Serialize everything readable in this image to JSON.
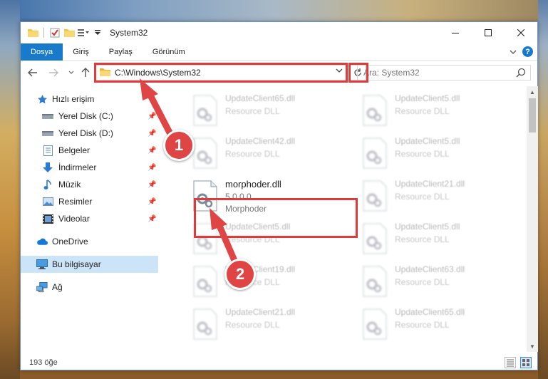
{
  "window": {
    "title": "System32",
    "controls": {
      "minimize": "—",
      "maximize": "☐",
      "close": "✕"
    }
  },
  "ribbon": {
    "tabs": [
      {
        "label": "Dosya",
        "active": true
      },
      {
        "label": "Giriş",
        "active": false
      },
      {
        "label": "Paylaş",
        "active": false
      },
      {
        "label": "Görünüm",
        "active": false
      }
    ],
    "help": "?"
  },
  "navigation": {
    "address_path": "C:\\Windows\\System32",
    "search_placeholder": "Ara: System32"
  },
  "sidebar": {
    "items": [
      {
        "label": "Hızlı erişim",
        "icon": "star-icon",
        "pinned": false
      },
      {
        "label": "Yerel Disk (C:)",
        "icon": "drive-icon",
        "pinned": true
      },
      {
        "label": "Yerel Disk (D:)",
        "icon": "drive-icon",
        "pinned": true
      },
      {
        "label": "Belgeler",
        "icon": "document-icon",
        "pinned": true
      },
      {
        "label": "İndirmeler",
        "icon": "download-icon",
        "pinned": true
      },
      {
        "label": "Müzik",
        "icon": "music-icon",
        "pinned": true
      },
      {
        "label": "Resimler",
        "icon": "picture-icon",
        "pinned": true
      },
      {
        "label": "Videolar",
        "icon": "video-icon",
        "pinned": true
      },
      {
        "label": "OneDrive",
        "icon": "cloud-icon",
        "pinned": false
      },
      {
        "label": "Bu bilgisayar",
        "icon": "computer-icon",
        "pinned": false,
        "selected": true
      },
      {
        "label": "Ağ",
        "icon": "network-icon",
        "pinned": false
      }
    ]
  },
  "files": {
    "left": [
      {
        "name": "UpdateClient65.dll",
        "desc": "Resource DLL"
      },
      {
        "name": "UpdateClient42.dll",
        "desc": "Resource DLL"
      },
      {
        "name": "morphoder.dll",
        "version": "5.0.0.0",
        "desc": "Morphoder",
        "highlighted": true
      },
      {
        "name": "UpdateClient5.dll",
        "desc": "Resource DLL"
      },
      {
        "name": "UpdateClient19.dll",
        "desc": "Resource DLL"
      },
      {
        "name": "UpdateClient21.dll",
        "desc": "Resource DLL"
      }
    ],
    "right": [
      {
        "name": "UpdateClient5.dll",
        "desc": "Resource DLL"
      },
      {
        "name": "UpdateClient5.dll",
        "desc": "Resource DLL"
      },
      {
        "name": "UpdateClient21.dll",
        "desc": "Resource DLL"
      },
      {
        "name": "UpdateClient5.dll",
        "desc": "Resource DLL"
      },
      {
        "name": "UpdateClient63.dll",
        "desc": "Resource DLL"
      },
      {
        "name": "UpdateClient65.dll",
        "desc": "Resource DLL"
      }
    ]
  },
  "status": {
    "item_count": "193 öğe"
  },
  "annotations": {
    "badge1": "1",
    "badge2": "2",
    "color": "#e04545"
  }
}
